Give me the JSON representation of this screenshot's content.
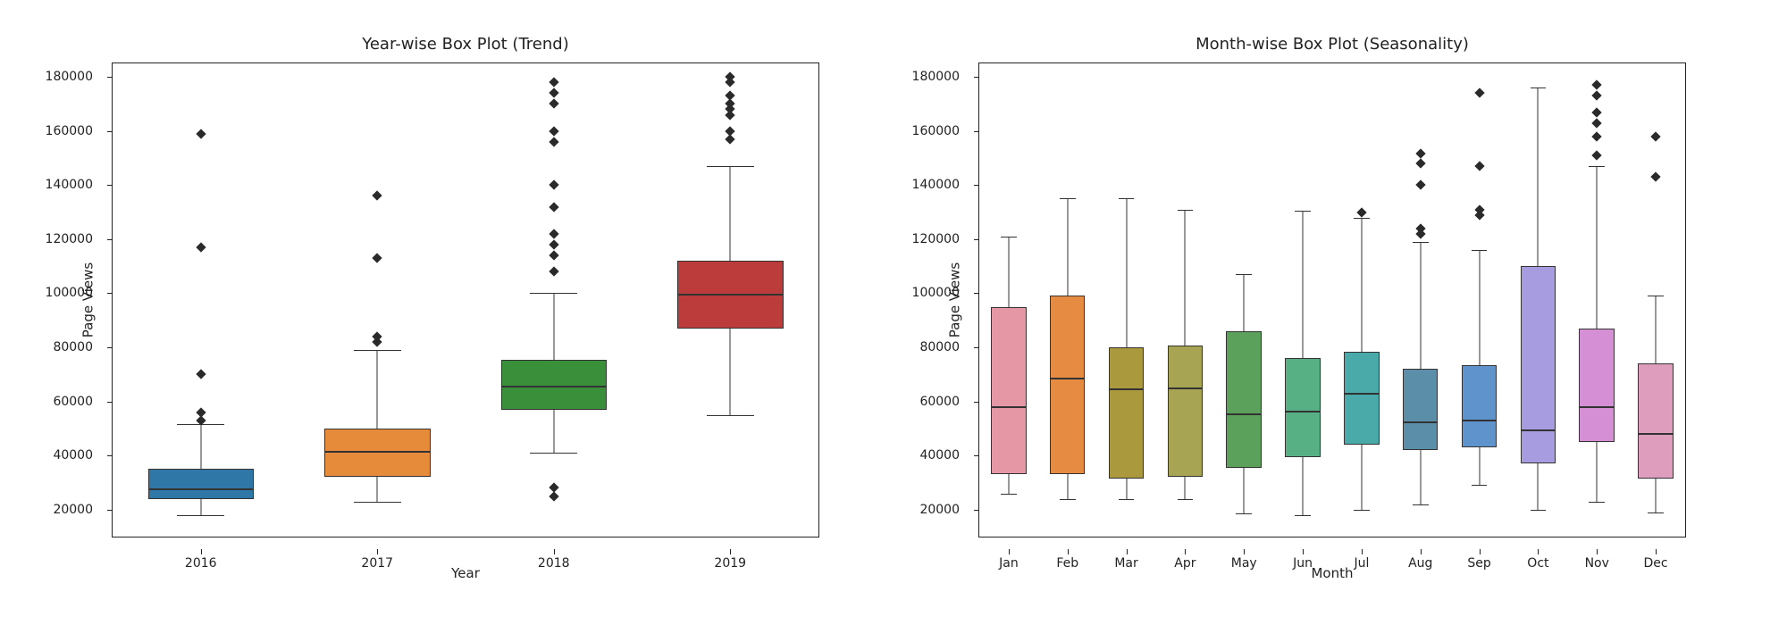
{
  "chart_data": [
    {
      "type": "box",
      "title": "Year-wise Box Plot (Trend)",
      "xlabel": "Year",
      "ylabel": "Page Views",
      "ylim": [
        10000,
        185000
      ],
      "yticks": [
        20000,
        40000,
        60000,
        80000,
        100000,
        120000,
        140000,
        160000,
        180000
      ],
      "categories": [
        "2016",
        "2017",
        "2018",
        "2019"
      ],
      "series": [
        {
          "name": "2016",
          "color": "#2f77a6",
          "q1": 24000,
          "median": 28000,
          "q3": 35000,
          "whisker_low": 18000,
          "whisker_high": 51500,
          "outliers": [
            53000,
            56000,
            70000,
            117000,
            159000
          ]
        },
        {
          "name": "2017",
          "color": "#e58b3a",
          "q1": 32000,
          "median": 42000,
          "q3": 50000,
          "whisker_low": 23000,
          "whisker_high": 79000,
          "outliers": [
            82000,
            84000,
            113000,
            136000
          ]
        },
        {
          "name": "2018",
          "color": "#3a8f3a",
          "q1": 57000,
          "median": 66000,
          "q3": 75500,
          "whisker_low": 41000,
          "whisker_high": 100000,
          "outliers": [
            25000,
            28000,
            108000,
            114000,
            118000,
            122000,
            132000,
            140000,
            156000,
            160000,
            170000,
            174000,
            178000
          ]
        },
        {
          "name": "2019",
          "color": "#bc3b3b",
          "q1": 87000,
          "median": 100000,
          "q3": 112000,
          "whisker_low": 55000,
          "whisker_high": 147000,
          "outliers": [
            157000,
            160000,
            166000,
            168000,
            170000,
            173000,
            178000,
            180000
          ]
        }
      ]
    },
    {
      "type": "box",
      "title": "Month-wise Box Plot (Seasonality)",
      "xlabel": "Month",
      "ylabel": "Page Views",
      "ylim": [
        10000,
        185000
      ],
      "yticks": [
        20000,
        40000,
        60000,
        80000,
        100000,
        120000,
        140000,
        160000,
        180000
      ],
      "categories": [
        "Jan",
        "Feb",
        "Mar",
        "Apr",
        "May",
        "Jun",
        "Jul",
        "Aug",
        "Sep",
        "Oct",
        "Nov",
        "Dec"
      ],
      "series": [
        {
          "name": "Jan",
          "color": "#e597a6",
          "q1": 33000,
          "median": 58500,
          "q3": 95000,
          "whisker_low": 26000,
          "whisker_high": 121000,
          "outliers": []
        },
        {
          "name": "Feb",
          "color": "#e58c42",
          "q1": 33000,
          "median": 69000,
          "q3": 99000,
          "whisker_low": 24000,
          "whisker_high": 135000,
          "outliers": []
        },
        {
          "name": "Mar",
          "color": "#ab9a3d",
          "q1": 31500,
          "median": 65000,
          "q3": 80000,
          "whisker_low": 24000,
          "whisker_high": 135000,
          "outliers": []
        },
        {
          "name": "Apr",
          "color": "#a7a553",
          "q1": 32000,
          "median": 65500,
          "q3": 80500,
          "whisker_low": 24000,
          "whisker_high": 131000,
          "outliers": []
        },
        {
          "name": "May",
          "color": "#5ba05b",
          "q1": 35500,
          "median": 56000,
          "q3": 86000,
          "whisker_low": 18500,
          "whisker_high": 107000,
          "outliers": []
        },
        {
          "name": "Jun",
          "color": "#56b083",
          "q1": 39500,
          "median": 57000,
          "q3": 76000,
          "whisker_low": 18000,
          "whisker_high": 130500,
          "outliers": []
        },
        {
          "name": "Jul",
          "color": "#4aa9a9",
          "q1": 44000,
          "median": 63500,
          "q3": 78500,
          "whisker_low": 20000,
          "whisker_high": 128000,
          "outliers": [
            130000
          ]
        },
        {
          "name": "Aug",
          "color": "#5b8fa9",
          "q1": 42000,
          "median": 53000,
          "q3": 72000,
          "whisker_low": 22000,
          "whisker_high": 119000,
          "outliers": [
            122000,
            124000,
            140000,
            148000,
            151500
          ]
        },
        {
          "name": "Sep",
          "color": "#5f93cc",
          "q1": 43000,
          "median": 53500,
          "q3": 73500,
          "whisker_low": 29000,
          "whisker_high": 116000,
          "outliers": [
            129000,
            131000,
            147000,
            174000
          ]
        },
        {
          "name": "Oct",
          "color": "#a89ce0",
          "q1": 37000,
          "median": 50000,
          "q3": 110000,
          "whisker_low": 20000,
          "whisker_high": 176000,
          "outliers": []
        },
        {
          "name": "Nov",
          "color": "#d58fd5",
          "q1": 45000,
          "median": 58500,
          "q3": 87000,
          "whisker_low": 23000,
          "whisker_high": 147000,
          "outliers": [
            151000,
            158000,
            163000,
            167000,
            173000,
            177000
          ]
        },
        {
          "name": "Dec",
          "color": "#df9dbd",
          "q1": 31500,
          "median": 48500,
          "q3": 74000,
          "whisker_low": 19000,
          "whisker_high": 99000,
          "outliers": [
            143000,
            158000
          ]
        }
      ]
    }
  ]
}
